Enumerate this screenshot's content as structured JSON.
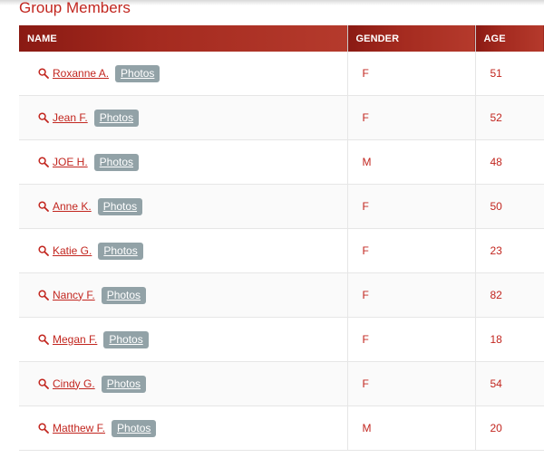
{
  "page": {
    "title": "Group Members"
  },
  "table": {
    "headers": {
      "name": "NAME",
      "gender": "GENDER",
      "age": "AGE"
    },
    "photos_label": "Photos",
    "rows": [
      {
        "name": "Roxanne A.",
        "gender": "F",
        "age": "51"
      },
      {
        "name": "Jean F.",
        "gender": "F",
        "age": "52"
      },
      {
        "name": "JOE H.",
        "gender": "M",
        "age": "48"
      },
      {
        "name": "Anne K.",
        "gender": "F",
        "age": "50"
      },
      {
        "name": "Katie G.",
        "gender": "F",
        "age": "23"
      },
      {
        "name": "Nancy F.",
        "gender": "F",
        "age": "82"
      },
      {
        "name": "Megan F.",
        "gender": "F",
        "age": "18"
      },
      {
        "name": "Cindy G.",
        "gender": "F",
        "age": "54"
      },
      {
        "name": "Matthew F.",
        "gender": "M",
        "age": "20"
      }
    ]
  },
  "colors": {
    "accent": "#c2261f",
    "header_bg": "#9b241b",
    "photos_button": "#92a2a7"
  },
  "icons": {
    "row_icon": "search-icon"
  }
}
